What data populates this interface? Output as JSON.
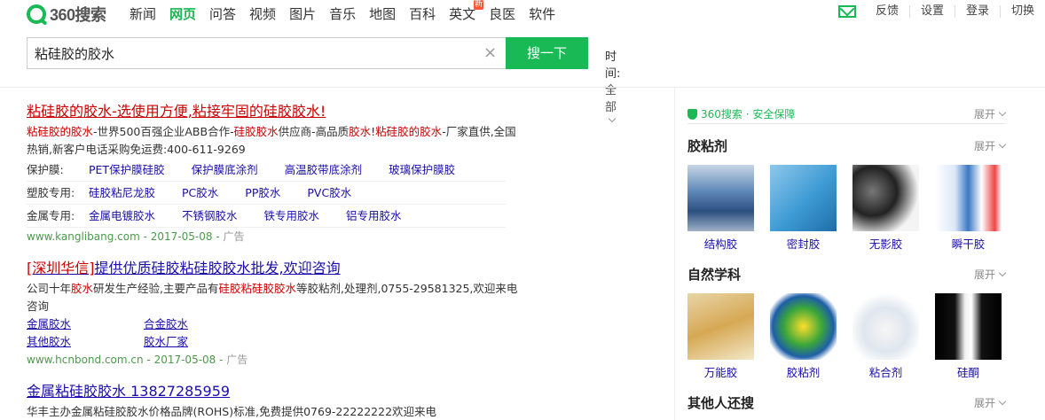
{
  "logo": {
    "text": "360搜索"
  },
  "nav": [
    {
      "label": "新闻"
    },
    {
      "label": "网页"
    },
    {
      "label": "问答"
    },
    {
      "label": "视频"
    },
    {
      "label": "图片"
    },
    {
      "label": "音乐"
    },
    {
      "label": "地图"
    },
    {
      "label": "百科"
    },
    {
      "label": "英文"
    },
    {
      "label": "良医"
    },
    {
      "label": "软件"
    }
  ],
  "nav_badge": "新",
  "toplinks": {
    "feedback": "反馈",
    "settings": "设置",
    "login": "登录",
    "switch": "切换"
  },
  "search": {
    "query": "粘硅胶的胶水",
    "button": "搜一下",
    "clear": "×"
  },
  "time_filter": {
    "label": "时间:",
    "value": "全部"
  },
  "results": [
    {
      "title": "粘硅胶的胶水-选使用方便,粘接牢固的硅胶胶水!",
      "desc": [
        {
          "t": "粘硅胶的胶水",
          "h": true
        },
        {
          "t": "-世界500百强企业ABB合作-",
          "h": false
        },
        {
          "t": "硅胶胶水",
          "h": true
        },
        {
          "t": "供应商-高品质",
          "h": false
        },
        {
          "t": "胶水",
          "h": true
        },
        {
          "t": "!",
          "h": false
        },
        {
          "t": "粘硅胶的胶水",
          "h": true
        },
        {
          "t": "-厂家直供,全国热销,新客户电话采购免运费:400-611-9269",
          "h": false
        }
      ],
      "sublinks": [
        {
          "label": "保护膜:",
          "links": [
            "PET保护膜硅胶",
            "保护膜底涂剂",
            "高温胶带底涂剂",
            "玻璃保护膜胶"
          ]
        },
        {
          "label": "塑胶专用:",
          "links": [
            "硅胶粘尼龙胶",
            "PC胶水",
            "PP胶水",
            "PVC胶水"
          ]
        },
        {
          "label": "金属专用:",
          "links": [
            "金属电镀胶水",
            "不锈钢胶水",
            "铁专用胶水",
            "铝专用胶水"
          ]
        }
      ],
      "url": "www.kanglibang.com - 2017-05-08 - ",
      "ad": "广告"
    },
    {
      "title_parts": [
        {
          "t": "[深圳华信]",
          "h": false
        },
        {
          "t": "提供优质硅胶粘硅胶胶水",
          "h": false
        },
        {
          "t": "批发,欢迎咨询",
          "h": false
        }
      ],
      "desc": [
        {
          "t": "公司十年",
          "h": false
        },
        {
          "t": "胶水",
          "h": true
        },
        {
          "t": "研发生产经验,主要产品有",
          "h": false
        },
        {
          "t": "硅胶粘硅胶胶水",
          "h": true
        },
        {
          "t": "等胶粘剂,处理剂,0755-29581325,欢迎来电咨询",
          "h": false
        }
      ],
      "grid_links": [
        "金属胶水",
        "合金胶水",
        "其他胶水",
        "胶水厂家"
      ],
      "url": "www.hcnbond.com.cn - 2017-05-08 - ",
      "ad": "广告"
    },
    {
      "title": "金属粘硅胶胶水 13827285959",
      "desc_partial": "华丰主办金属粘硅胶胶水价格品牌(ROHS)标准,免费提供0769-22222222欢迎来电"
    }
  ],
  "right": {
    "safe": {
      "label": "360搜索 · 安全保障",
      "expand": "展开"
    },
    "sections": [
      {
        "title": "胶粘剂",
        "expand": "展开",
        "items": [
          {
            "cap": "结构胶"
          },
          {
            "cap": "密封胶"
          },
          {
            "cap": "无影胶"
          },
          {
            "cap": "瞬干胶"
          }
        ]
      },
      {
        "title": "自然学科",
        "expand": "展开",
        "items": [
          {
            "cap": "万能胶"
          },
          {
            "cap": "胶粘剂"
          },
          {
            "cap": "粘合剂"
          },
          {
            "cap": "硅酮"
          }
        ]
      },
      {
        "title": "其他人还搜",
        "expand": "展开"
      }
    ]
  },
  "colors": {
    "brand": "#19b955",
    "link": "#1a0dab",
    "highlight": "#cc0000",
    "url": "#4a9a4a"
  }
}
